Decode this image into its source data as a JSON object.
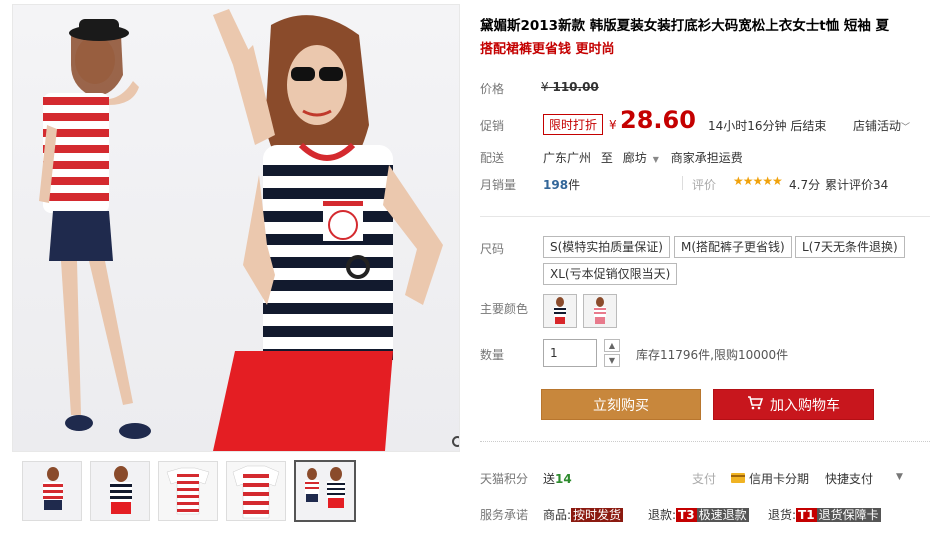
{
  "product": {
    "title": "黛媚斯2013新款 韩版夏装女装打底衫大码宽松上衣女士t恤 短袖 夏",
    "subtitle": "搭配裙裤更省钱 更时尚"
  },
  "price": {
    "label": "价格",
    "currency": "¥",
    "original": "110.00"
  },
  "promo": {
    "label": "促销",
    "tag": "限时打折",
    "currency": "¥",
    "price": "28.60",
    "countdown": "14小时16分钟 后结束",
    "shop_activity": "店铺活动"
  },
  "shipping": {
    "label": "配送",
    "from": "广东广州",
    "to_word": "至",
    "to": "廊坊",
    "fee": "商家承担运费"
  },
  "sales": {
    "label": "月销量",
    "count": "198",
    "unit": "件",
    "rating_label": "评价",
    "stars": "★★★★★",
    "score": "4.7分",
    "review_count": "累计评价34"
  },
  "size": {
    "label": "尺码",
    "options": [
      "S(模特实拍质量保证)",
      "M(搭配裤子更省钱)",
      "L(7天无条件退换)",
      "XL(亏本促销仅限当天)"
    ]
  },
  "color": {
    "label": "主要颜色",
    "swatch_colors": [
      "#d8262a",
      "#e87a8c"
    ]
  },
  "quantity": {
    "label": "数量",
    "value": "1",
    "stock": "库存11796件,限购10000件"
  },
  "actions": {
    "buy_now": "立刻购买",
    "add_to_cart": "加入购物车"
  },
  "points": {
    "label": "天猫积分",
    "prefix": "送",
    "value": "14"
  },
  "payment": {
    "label": "支付",
    "card": "信用卡分期",
    "quick": "快捷支付"
  },
  "service": {
    "label": "服务承诺",
    "goods_label": "商品:",
    "goods_tag": "按时发货",
    "refund_label": "退款:",
    "refund_code": "T3",
    "refund_tag": "极速退款",
    "return_label": "退货:",
    "return_code": "T1",
    "return_tag": "退货保障卡"
  },
  "colors": {
    "accent_red": "#c40000",
    "buy_orange": "#c8873c",
    "cart_red": "#c8161d"
  }
}
